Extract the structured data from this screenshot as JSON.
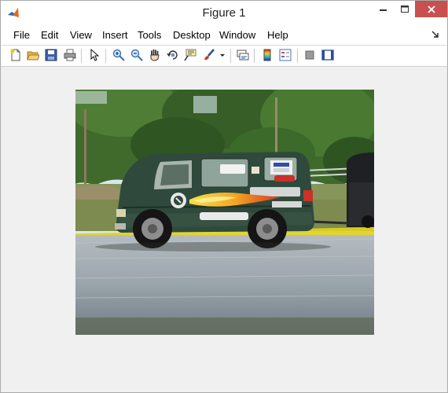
{
  "window": {
    "title": "Figure 1"
  },
  "menu": {
    "items": [
      "File",
      "Edit",
      "View",
      "Insert",
      "Tools",
      "Desktop",
      "Window",
      "Help"
    ]
  },
  "toolbar": {
    "buttons": [
      "new-figure-icon",
      "open-file-icon",
      "save-icon",
      "print-icon",
      "edit-plot-arrow-icon",
      "zoom-in-icon",
      "zoom-out-icon",
      "pan-hand-icon",
      "rotate-3d-icon",
      "data-cursor-icon",
      "brush-icon",
      "brush-dropdown-icon",
      "link-plot-icon",
      "colorbar-icon",
      "legend-icon",
      "hide-plot-tools-icon",
      "show-plot-tools-icon"
    ]
  },
  "image": {
    "subject": "dark green van with sticker graphics on gravel lot towing a trailer",
    "colors": {
      "sky": "#cfe2ee",
      "trees": "#3f6a2c",
      "van_body": "#2f4a3c",
      "gravel": "#9aa4ab",
      "flames": "#f3b423"
    }
  }
}
